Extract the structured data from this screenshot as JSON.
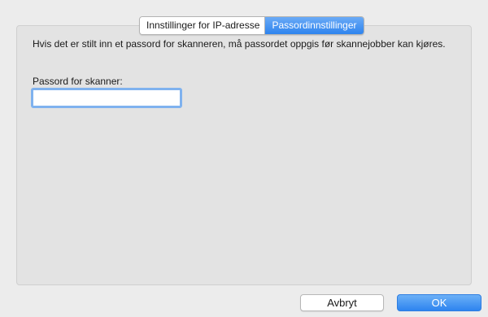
{
  "tabs": {
    "ip_settings": "Innstillinger for IP-adresse",
    "password_settings": "Passordinnstillinger",
    "active": "password_settings"
  },
  "content": {
    "description": "Hvis det er stilt inn et passord for skanneren, må passordet oppgis før skannejobber kan kjøres.",
    "password_label": "Passord for skanner:",
    "password_value": ""
  },
  "buttons": {
    "cancel": "Avbryt",
    "ok": "OK"
  },
  "colors": {
    "accent": "#2e84ee",
    "panel_background": "#e3e3e3",
    "window_background": "#ececec"
  }
}
